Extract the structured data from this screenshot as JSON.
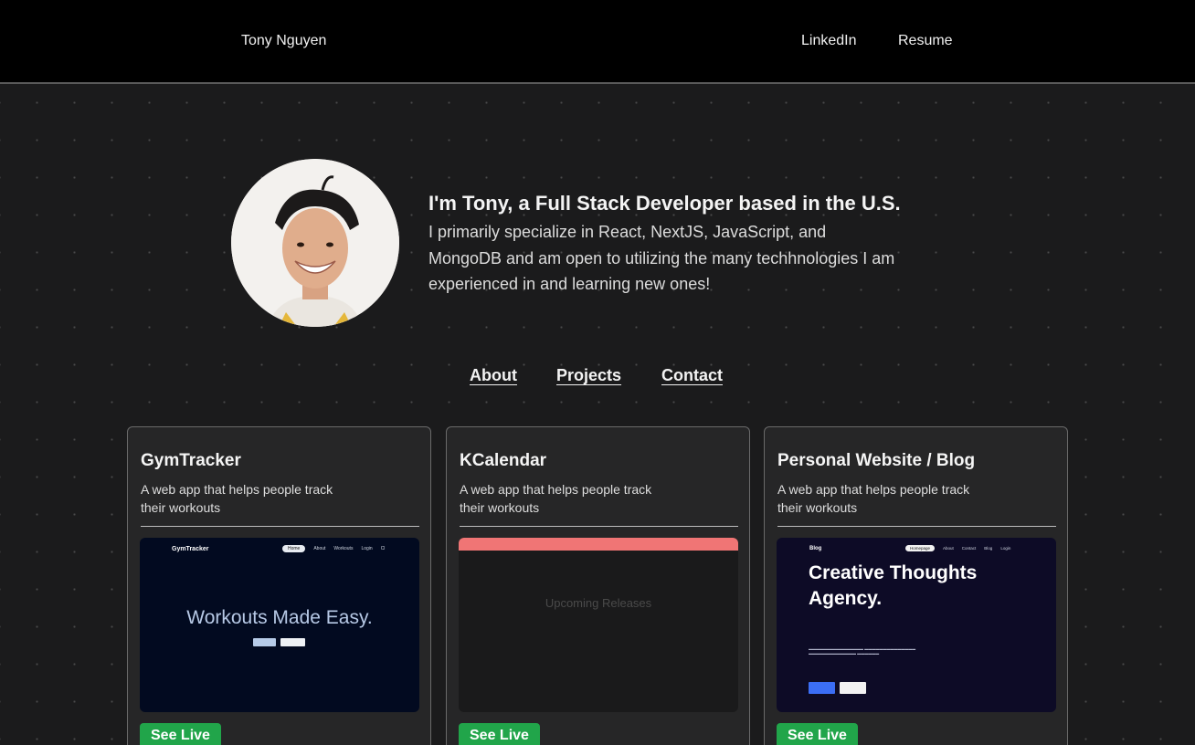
{
  "header": {
    "brand": "Tony Nguyen",
    "links": [
      {
        "label": "LinkedIn"
      },
      {
        "label": "Resume"
      }
    ]
  },
  "hero": {
    "title": "I'm Tony, a Full Stack Developer based in the U.S.",
    "description": "I primarily specialize in React, NextJS, JavaScript, and MongoDB and am open to utilizing the many techhnologies I am experienced in and learning new ones!"
  },
  "nav": [
    {
      "label": "About"
    },
    {
      "label": "Projects"
    },
    {
      "label": "Contact"
    }
  ],
  "projects": [
    {
      "title": "GymTracker",
      "description": "A web app that helps people track their workouts",
      "cta": "See Live",
      "preview": {
        "logo": "GymTracker",
        "nav": [
          "Home",
          "About",
          "Workouts",
          "Login",
          "Cl"
        ],
        "headline": "Workouts Made Easy."
      }
    },
    {
      "title": "KCalendar",
      "description": "A web app that helps people track their workouts",
      "cta": "See Live",
      "preview": {
        "headline": "Upcoming Releases"
      }
    },
    {
      "title": "Personal Website / Blog",
      "description": "A web app that helps people track their workouts",
      "cta": "See Live",
      "preview": {
        "logo": "Blog",
        "nav": [
          "Homepage",
          "About",
          "Contact",
          "Blog",
          "Login"
        ],
        "headline": "Creative Thoughts Agency."
      }
    }
  ],
  "colors": {
    "background": "#1b1b1c",
    "card": "#262627",
    "accent_green": "#21a54a",
    "topbar": "#000000"
  }
}
